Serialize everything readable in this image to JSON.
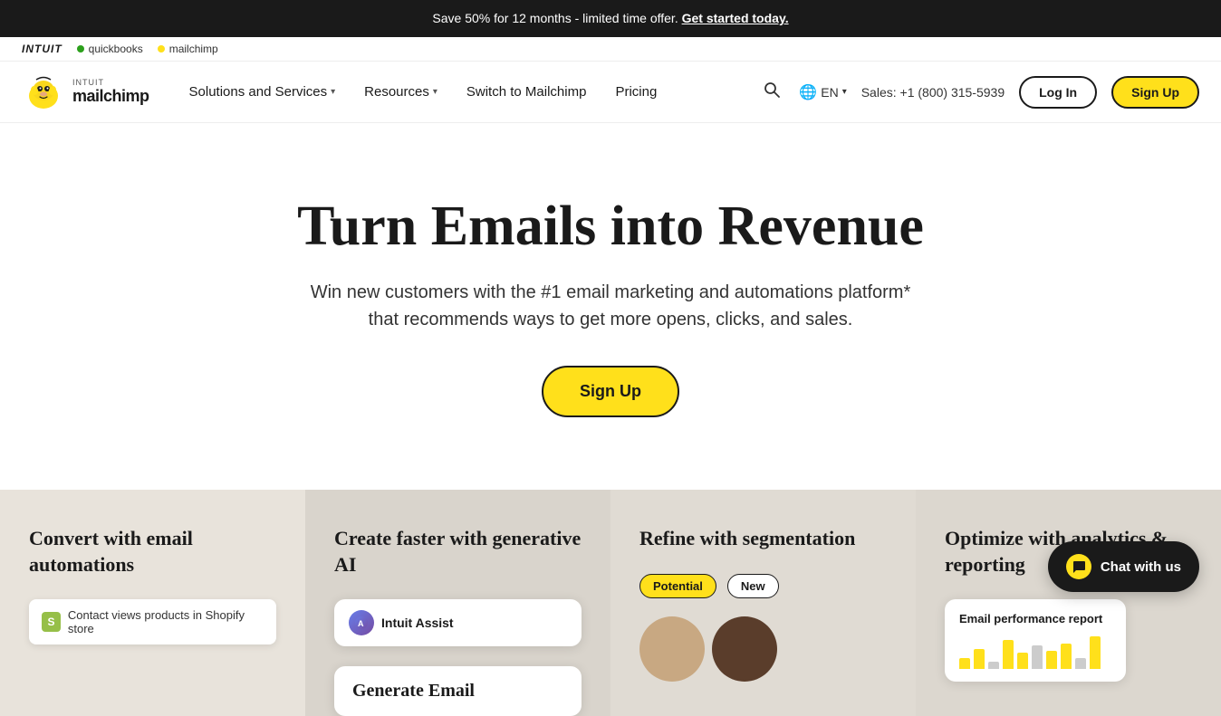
{
  "top_banner": {
    "text": "Save 50% for 12 months - limited time offer.",
    "cta": "Get started today.",
    "cta_url": "#"
  },
  "intuit_bar": {
    "intuit_label": "INTUIT",
    "quickbooks_label": "quickbooks",
    "mailchimp_label": "mailchimp"
  },
  "nav": {
    "logo": {
      "intuit_small": "INTUIT",
      "mailchimp": "mailchimp"
    },
    "links": [
      {
        "label": "Solutions and Services",
        "has_dropdown": true
      },
      {
        "label": "Resources",
        "has_dropdown": true
      },
      {
        "label": "Switch to Mailchimp",
        "has_dropdown": false
      },
      {
        "label": "Pricing",
        "has_dropdown": false
      }
    ],
    "lang": "EN",
    "sales": "Sales: +1 (800) 315-5939",
    "login_label": "Log In",
    "signup_label": "Sign Up"
  },
  "hero": {
    "headline": "Turn Emails into Revenue",
    "subtext": "Win new customers with the #1 email marketing and automations platform*\nthat recommends ways to get more opens, clicks, and sales.",
    "cta": "Sign Up"
  },
  "feature_cards": [
    {
      "title": "Convert with email automations",
      "card_type": "automations",
      "shopify_text": "Contact views products in Shopify store"
    },
    {
      "title": "Create faster with generative AI",
      "card_type": "ai",
      "assist_label": "Intuit Assist",
      "generate_label": "Generate Email"
    },
    {
      "title": "Refine with segmentation",
      "card_type": "segmentation",
      "badge_potential": "Potential",
      "badge_new": "New"
    },
    {
      "title": "Optimize with analytics & reporting",
      "card_type": "analytics",
      "report_title": "Email performance report",
      "bars": [
        30,
        45,
        20,
        60,
        35,
        50,
        40,
        55,
        25,
        65
      ]
    }
  ],
  "chat_widget": {
    "label": "Chat with us"
  }
}
